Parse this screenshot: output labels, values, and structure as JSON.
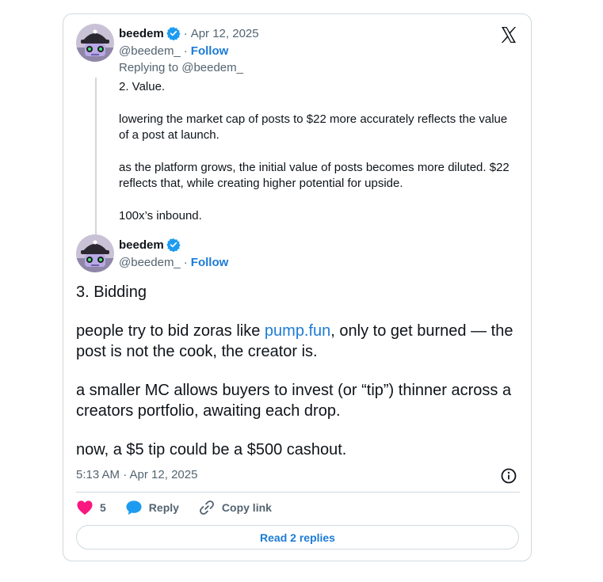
{
  "quoted": {
    "author_name": "beedem",
    "date": "Apr 12, 2025",
    "handle": "@beedem_",
    "follow_label": "Follow",
    "replying_to": "Replying to @beedem_",
    "paragraphs": [
      "2. Value.",
      "lowering the market cap of posts to $22 more accurately reflects the value of a post at launch.",
      "as the platform grows, the initial value of posts becomes more diluted. $22 reflects that, while creating higher potential for upside.",
      "100x’s inbound."
    ]
  },
  "main": {
    "author_name": "beedem",
    "handle": "@beedem_",
    "follow_label": "Follow",
    "p1": "3. Bidding",
    "p2_before": "people try to bid zoras like ",
    "p2_link": "pump.fun",
    "p2_after": ", only to get burned — the post is not the cook, the creator is.",
    "p3": "a smaller MC allows buyers to invest (or “tip”) thinner across a creators portfolio, awaiting each drop.",
    "p4": "now, a $5 tip could be a $500 cashout.",
    "timestamp": "5:13 AM · Apr 12, 2025"
  },
  "actions": {
    "like_count": "5",
    "reply_label": "Reply",
    "copy_link_label": "Copy link"
  },
  "read_replies_label": "Read 2 replies",
  "colors": {
    "accent": "#1d7bd6",
    "like": "#f91880",
    "verified": "#1d9bf0",
    "muted": "#536471",
    "border": "#cfd9de"
  }
}
